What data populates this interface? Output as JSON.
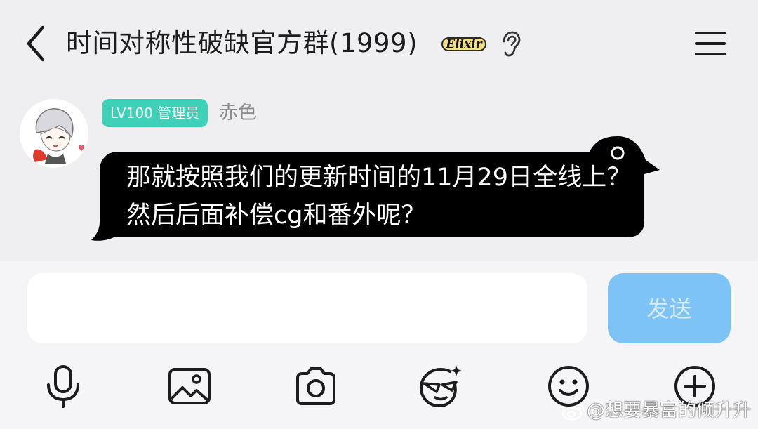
{
  "header": {
    "title": "时间对称性破缺官方群(1999)",
    "badge_text": "Elixir",
    "back_icon": "chevron-left-icon",
    "menu_icon": "hamburger-menu-icon",
    "ear_icon": "ear-icon"
  },
  "message": {
    "level_badge": "LV100 管理员",
    "sender": "赤色",
    "text": "那就按照我们的更新时间的11月29日全线上？  然后后面补偿cg和番外呢？",
    "bubble_color": "#000000",
    "badge_color": "#3fd0b8"
  },
  "composer": {
    "input_value": "",
    "input_placeholder": "",
    "send_label": "发送",
    "send_color": "#7ec3f5"
  },
  "toolbar": [
    {
      "icon": "microphone-icon"
    },
    {
      "icon": "image-icon"
    },
    {
      "icon": "camera-icon"
    },
    {
      "icon": "sticker-face-icon"
    },
    {
      "icon": "emoji-icon"
    },
    {
      "icon": "plus-circle-icon"
    }
  ],
  "watermark": "@想要暴富的倾升升"
}
